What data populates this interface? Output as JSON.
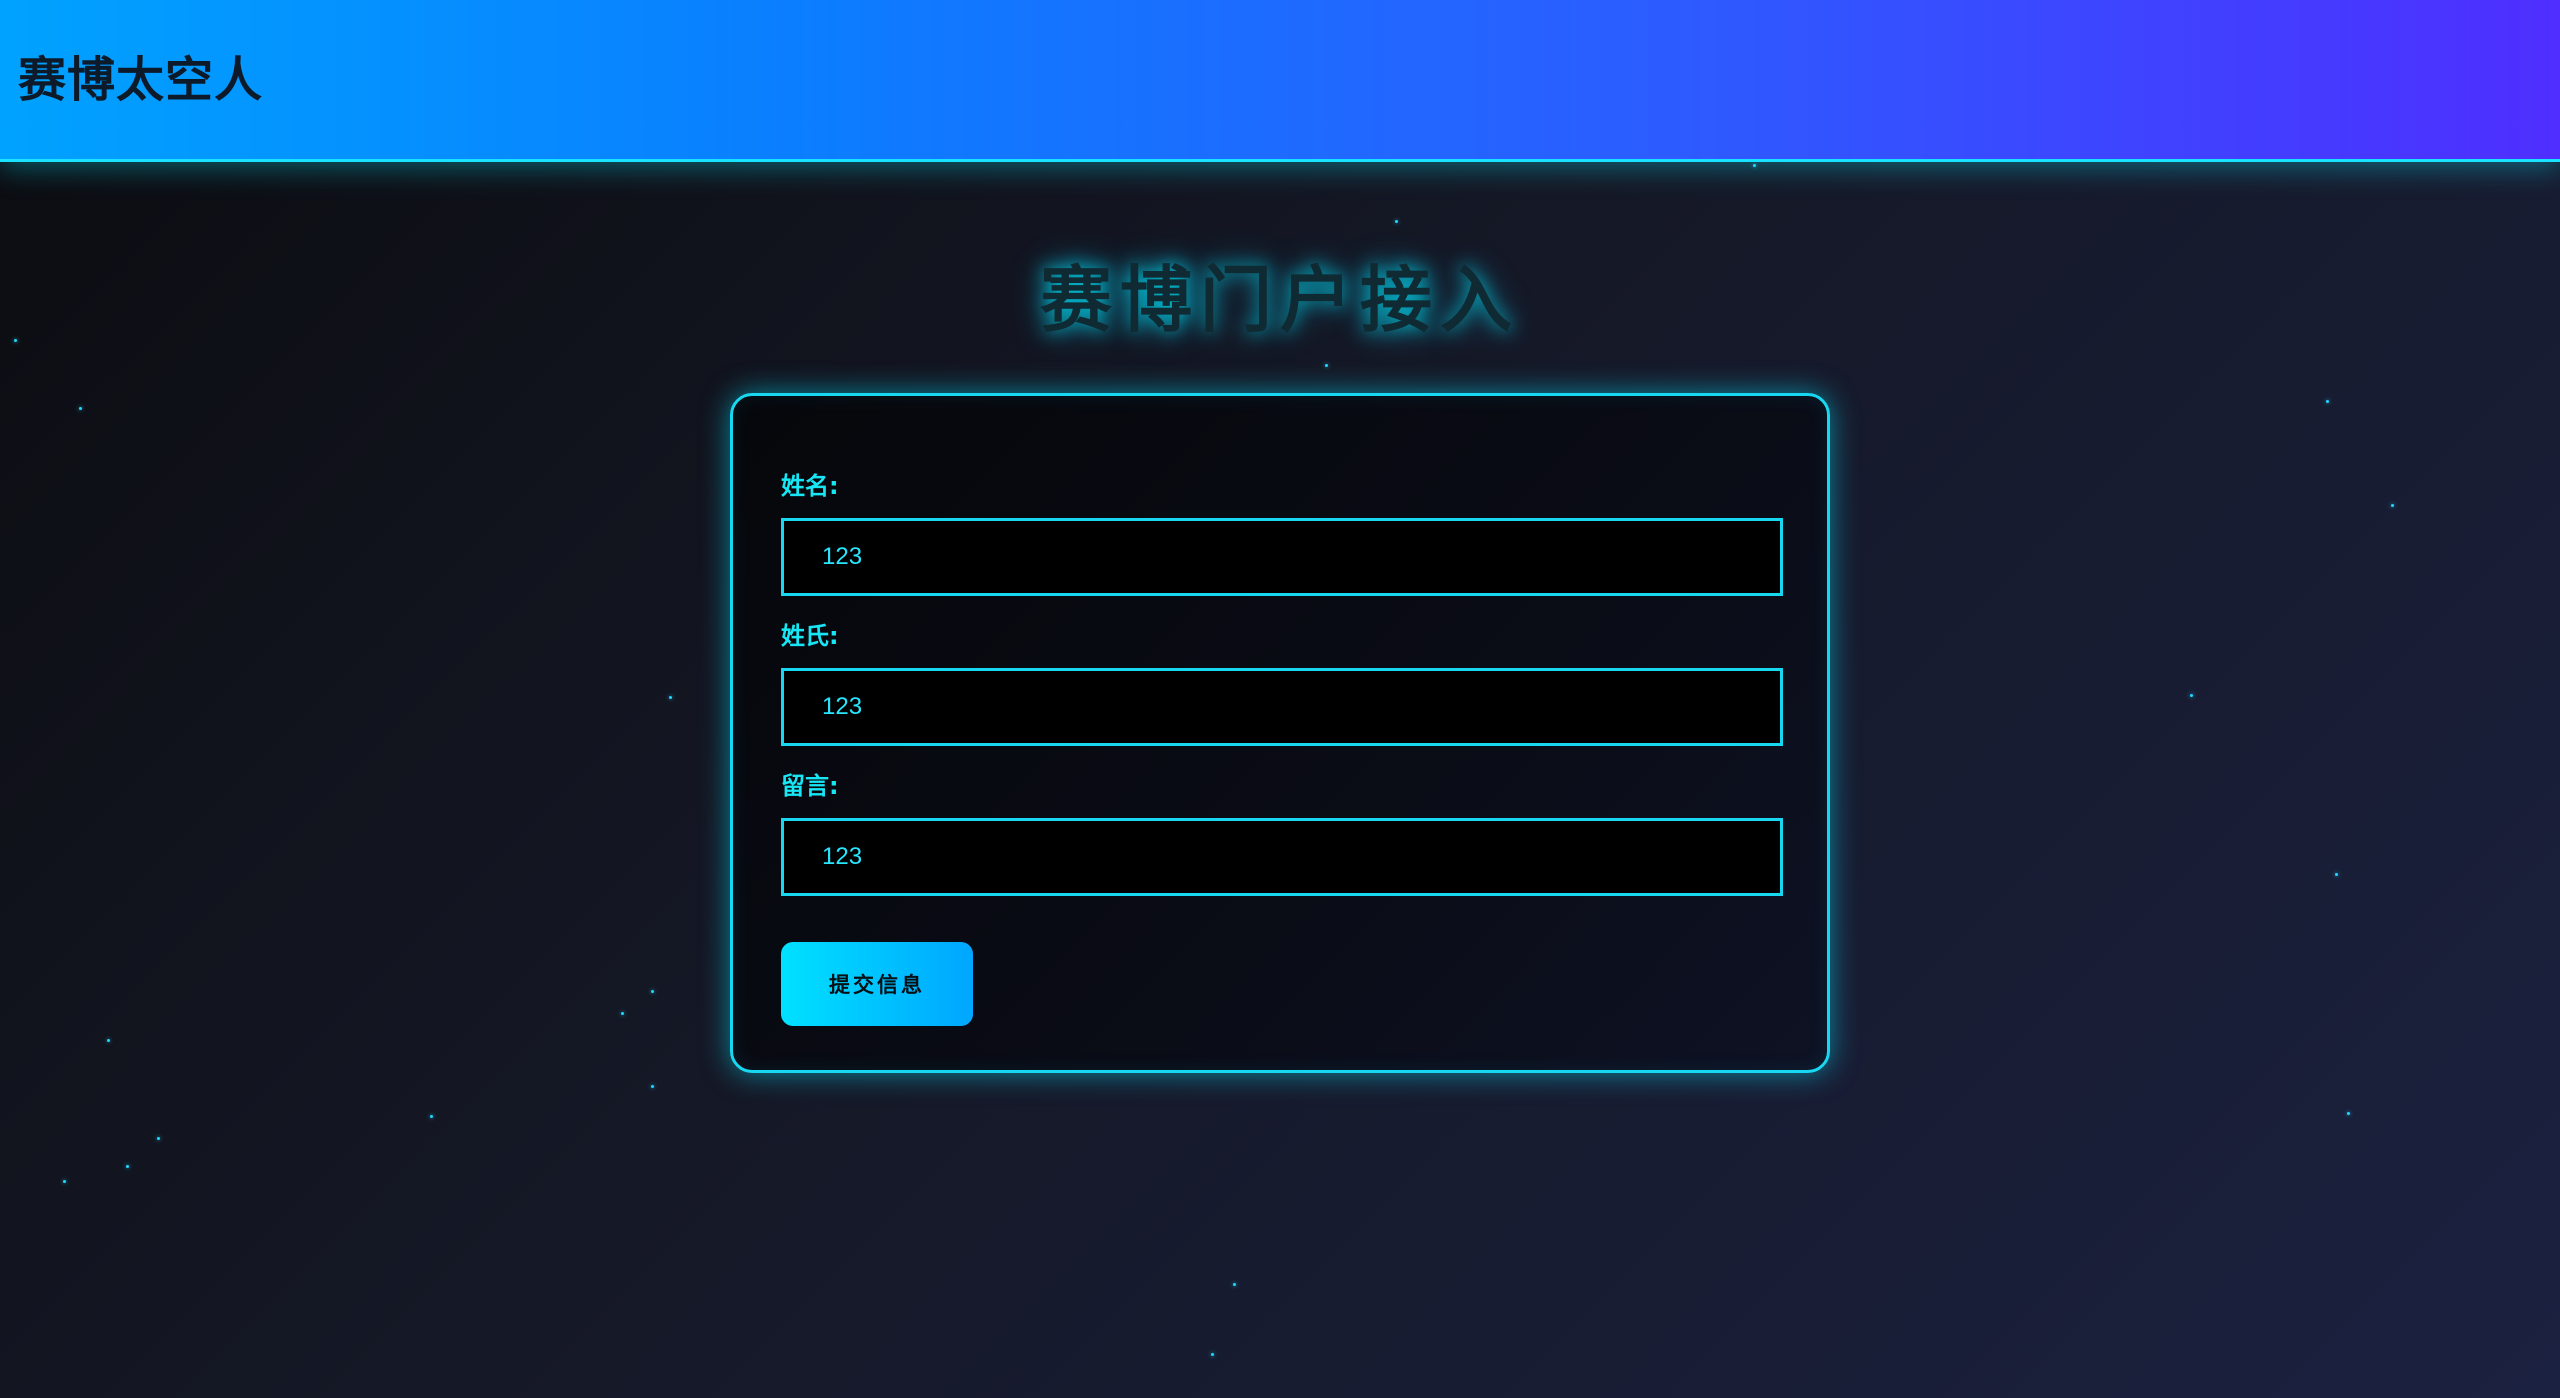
{
  "header": {
    "brand": "赛博太空人"
  },
  "page_title": "赛博门户接入",
  "form": {
    "first_name": {
      "label": "姓名:",
      "value": "123"
    },
    "last_name": {
      "label": "姓氏:",
      "value": "123"
    },
    "message": {
      "label": "留言:",
      "value": "123"
    },
    "submit_label": "提交信息"
  },
  "colors": {
    "accent": "#17d8f0",
    "header_start": "#00a2ff",
    "header_end": "#4f2eff",
    "background": "#151826"
  }
}
